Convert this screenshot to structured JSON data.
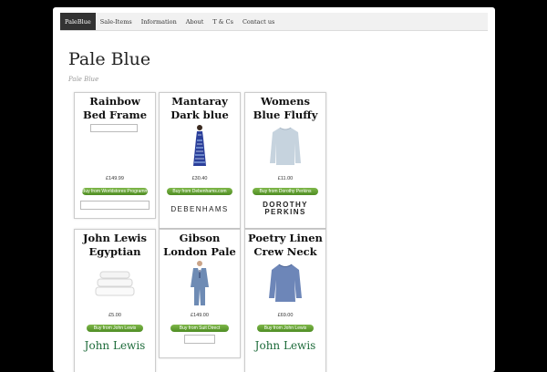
{
  "nav": {
    "items": [
      "PaleBlue",
      "Sale-Items",
      "Information",
      "About",
      "T & Cs",
      "Contact us"
    ]
  },
  "site": {
    "title": "Pale Blue",
    "tagline": "Pale Blue"
  },
  "products": [
    {
      "title": "Rainbow Bed Frame In Blue,",
      "price": "£149.99",
      "button": "Buy from Worldstores Programme",
      "retailer_logo": ""
    },
    {
      "title": "Mantaray Dark blue leafy halter",
      "price": "£30.40",
      "button": "Buy from Debenhams.com",
      "retailer_logo": "DEBENHAMS",
      "image_icon": "maxi-dress-image"
    },
    {
      "title": "Womens Blue Fluffy Jumper-",
      "price": "£11.00",
      "button": "Buy from Dorothy Perkins",
      "retailer_logo_line1": "DOROTHY",
      "retailer_logo_line2": "PERKINS",
      "image_icon": "jumper-image"
    },
    {
      "title": "John Lewis Egyptian Cotton",
      "price": "£5.00",
      "button": "Buy from John Lewis",
      "retailer_logo": "John Lewis",
      "image_icon": "towels-image"
    },
    {
      "title": "Gibson London Pale Blue Two",
      "price": "£149.00",
      "button": "Buy from Suit Direct",
      "retailer_logo": "",
      "image_icon": "suit-image"
    },
    {
      "title": "Poetry Linen Crew Neck",
      "price": "£69.00",
      "button": "Buy from John Lewis",
      "retailer_logo": "John Lewis",
      "image_icon": "sweater-image"
    }
  ],
  "colors": {
    "button_green": "#5a9a2c",
    "john_lewis_green": "#1d6b3a",
    "nav_active": "#333333"
  }
}
